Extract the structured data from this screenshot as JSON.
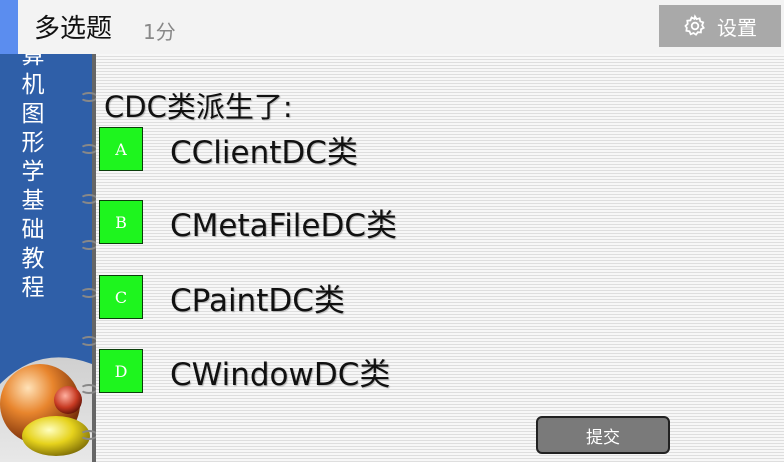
{
  "header": {
    "question_type": "多选题",
    "score": "1分",
    "settings_label": "设置"
  },
  "cover": {
    "title_chars": [
      "算",
      "机",
      "图",
      "形",
      "学",
      "基",
      "础",
      "教",
      "程"
    ]
  },
  "question": {
    "text": "CDC类派生了:",
    "options": [
      {
        "letter": "A",
        "text": "CClientDC类"
      },
      {
        "letter": "B",
        "text": "CMetaFileDC类"
      },
      {
        "letter": "C",
        "text": "CPaintDC类"
      },
      {
        "letter": "D",
        "text": "CWindowDC类"
      }
    ]
  },
  "submit_label": "提交",
  "colors": {
    "accent": "#5b8def",
    "option_green": "#1ef51e",
    "settings_bg": "#a9a9a9",
    "submit_bg": "#7a7a7a",
    "cover_blue": "#2f5fa8"
  }
}
